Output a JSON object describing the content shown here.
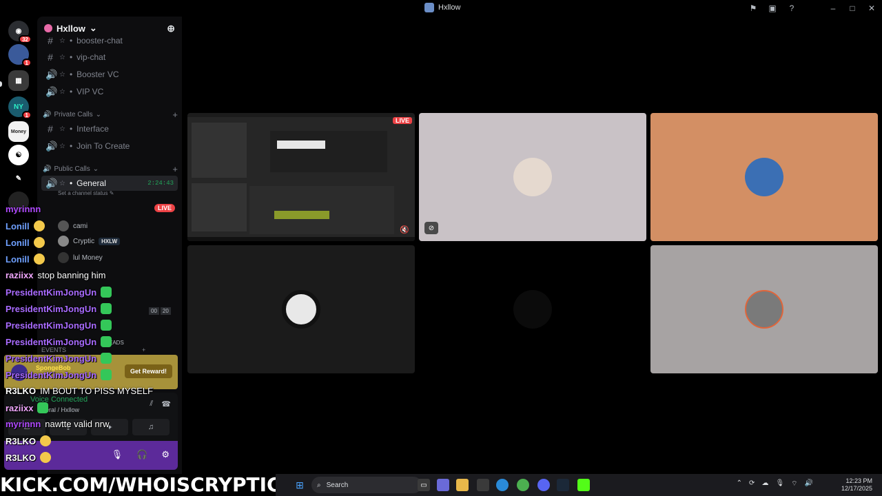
{
  "window": {
    "title": "Hxllow"
  },
  "rail": {
    "dm_badge": "32",
    "srv2_badge": "1",
    "ny_badge": "1",
    "ny_label": "NY",
    "money_label": "Money"
  },
  "server": {
    "name": "Hxllow"
  },
  "channels": {
    "booster_chat": "booster-chat",
    "vip_chat": "vip-chat",
    "booster_vc": "Booster VC",
    "vip_vc": "VIP VC",
    "private_calls": "Private Calls",
    "interface": "Interface",
    "join_to_create": "Join To Create",
    "public_calls": "Public Calls",
    "general": "General",
    "general_time": "2:24:43",
    "status_placeholder": "Set a channel status",
    "star": "☆",
    "dot": "•"
  },
  "voice_users": [
    {
      "name": "cami"
    },
    {
      "name": "Cryptic",
      "tag": "HXLW"
    },
    {
      "name": "lul Money"
    }
  ],
  "live_label": "LIVE",
  "counter": {
    "a": "00",
    "b": "20"
  },
  "events_label": "EVENTS",
  "threads_label": "EADS",
  "reward": {
    "brand": "SpongeBob",
    "button": "Get Reward!"
  },
  "voice_panel": {
    "status": "Voice Connected",
    "location": "eral / Hxllow"
  },
  "chat": [
    {
      "user": "myrinnn",
      "color": "#b04aff",
      "msg": ""
    },
    {
      "user": "Lonill",
      "color": "#6fa0ff",
      "msg": ""
    },
    {
      "user": "Lonill",
      "color": "#6fa0ff",
      "msg": ""
    },
    {
      "user": "Lonill",
      "color": "#6fa0ff",
      "msg": ""
    },
    {
      "user": "raziixx",
      "color": "#f2a8ff",
      "msg": "stop banning him"
    },
    {
      "user": "PresidentKimJongUn",
      "color": "#a96bff",
      "msg": ""
    },
    {
      "user": "PresidentKimJongUn",
      "color": "#a96bff",
      "msg": ""
    },
    {
      "user": "PresidentKimJongUn",
      "color": "#a96bff",
      "msg": ""
    },
    {
      "user": "PresidentKimJongUn",
      "color": "#a96bff",
      "msg": ""
    },
    {
      "user": "PresidentKimJongUn",
      "color": "#a96bff",
      "msg": ""
    },
    {
      "user": "PresidentKimJongUn",
      "color": "#a96bff",
      "msg": ""
    },
    {
      "user": "R3LKO",
      "color": "#ffffff",
      "msg": "IM BOUT TO PISS MYSELF"
    },
    {
      "user": "raziixx",
      "color": "#f2a8ff",
      "msg": ""
    },
    {
      "user": "myrinnn",
      "color": "#b04aff",
      "msg": "nawtte valid nrw"
    },
    {
      "user": "R3LKO",
      "color": "#ffffff",
      "msg": ""
    },
    {
      "user": "R3LKO",
      "color": "#ffffff",
      "msg": ""
    }
  ],
  "stage": {
    "live_label": "LIVE"
  },
  "kick": "KICK.COM/WHOISCRYPTIC",
  "taskbar": {
    "search_placeholder": "Search",
    "time": "12:23 PM",
    "date": "12/17/2025"
  },
  "colors": {
    "live": "#ed4245",
    "connected": "#23a55a",
    "tile_pink": "#c9c2c6",
    "tile_orange": "#d38f64",
    "tile_gray": "#a7a3a3"
  }
}
